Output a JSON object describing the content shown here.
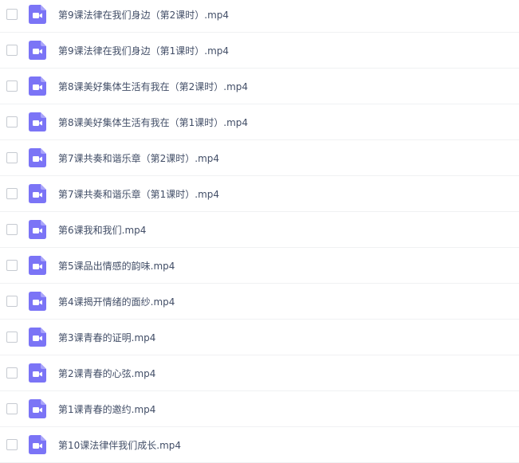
{
  "file_list": {
    "items": [
      {
        "name": "第9课法律在我们身边（第2课时）.mp4",
        "icon": "video-file-icon"
      },
      {
        "name": "第9课法律在我们身边（第1课时）.mp4",
        "icon": "video-file-icon"
      },
      {
        "name": "第8课美好集体生活有我在（第2课时）.mp4",
        "icon": "video-file-icon"
      },
      {
        "name": "第8课美好集体生活有我在（第1课时）.mp4",
        "icon": "video-file-icon"
      },
      {
        "name": "第7课共奏和谐乐章（第2课时）.mp4",
        "icon": "video-file-icon"
      },
      {
        "name": "第7课共奏和谐乐章（第1课时）.mp4",
        "icon": "video-file-icon"
      },
      {
        "name": "第6课我和我们.mp4",
        "icon": "video-file-icon"
      },
      {
        "name": "第5课品出情感的韵味.mp4",
        "icon": "video-file-icon"
      },
      {
        "name": "第4课揭开情绪的面纱.mp4",
        "icon": "video-file-icon"
      },
      {
        "name": "第3课青春的证明.mp4",
        "icon": "video-file-icon"
      },
      {
        "name": "第2课青春的心弦.mp4",
        "icon": "video-file-icon"
      },
      {
        "name": "第1课青春的邀约.mp4",
        "icon": "video-file-icon"
      },
      {
        "name": "第10课法律伴我们成长.mp4",
        "icon": "video-file-icon"
      }
    ]
  },
  "colors": {
    "icon_purple": "#7b74f6",
    "text": "#424e67",
    "divider": "#f0f1f3",
    "checkbox_border": "#c6cad1"
  }
}
